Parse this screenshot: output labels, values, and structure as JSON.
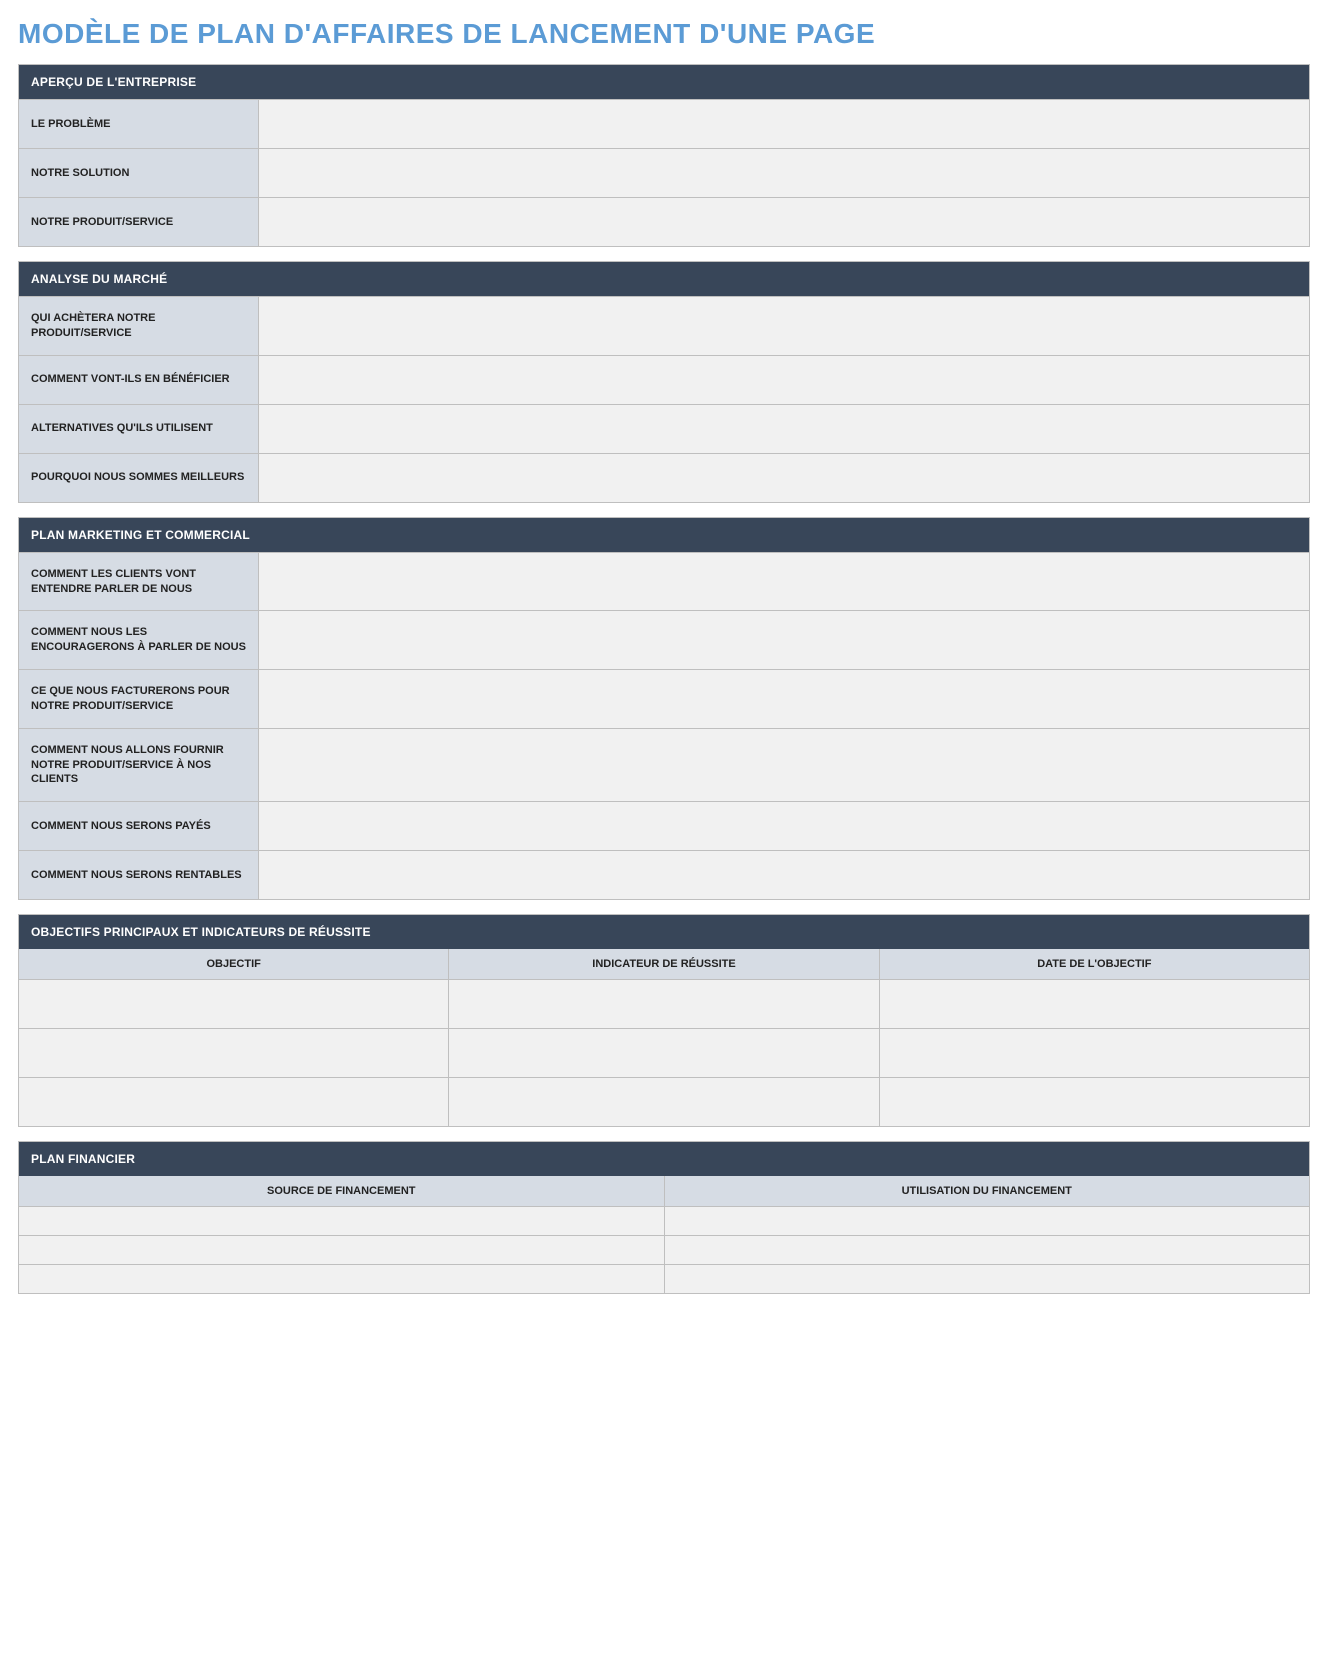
{
  "title": "MODÈLE DE PLAN D'AFFAIRES DE LANCEMENT D'UNE PAGE",
  "sections": {
    "overview": {
      "header": "APERÇU DE L'ENTREPRISE",
      "rows": [
        {
          "label": "LE PROBLÈME",
          "value": ""
        },
        {
          "label": "NOTRE SOLUTION",
          "value": ""
        },
        {
          "label": "NOTRE PRODUIT/SERVICE",
          "value": ""
        }
      ]
    },
    "market": {
      "header": "ANALYSE DU MARCHÉ",
      "rows": [
        {
          "label": "QUI ACHÈTERA NOTRE PRODUIT/SERVICE",
          "value": ""
        },
        {
          "label": "COMMENT VONT-ILS EN BÉNÉFICIER",
          "value": ""
        },
        {
          "label": "ALTERNATIVES QU'ILS UTILISENT",
          "value": ""
        },
        {
          "label": "POURQUOI NOUS SOMMES MEILLEURS",
          "value": ""
        }
      ]
    },
    "marketing": {
      "header": "PLAN MARKETING ET COMMERCIAL",
      "rows": [
        {
          "label": "COMMENT LES CLIENTS VONT ENTENDRE PARLER DE NOUS",
          "value": ""
        },
        {
          "label": "COMMENT NOUS LES ENCOURAGERONS À PARLER DE NOUS",
          "value": ""
        },
        {
          "label": "CE QUE NOUS FACTURERONS POUR NOTRE PRODUIT/SERVICE",
          "value": ""
        },
        {
          "label": "COMMENT NOUS ALLONS FOURNIR NOTRE PRODUIT/SERVICE À NOS CLIENTS",
          "value": ""
        },
        {
          "label": "COMMENT NOUS SERONS PAYÉS",
          "value": ""
        },
        {
          "label": "COMMENT NOUS SERONS RENTABLES",
          "value": ""
        }
      ]
    },
    "objectives": {
      "header": "OBJECTIFS PRINCIPAUX ET INDICATEURS DE RÉUSSITE",
      "columns": [
        "OBJECTIF",
        "INDICATEUR DE RÉUSSITE",
        "DATE DE L'OBJECTIF"
      ],
      "rows": [
        [
          "",
          "",
          ""
        ],
        [
          "",
          "",
          ""
        ],
        [
          "",
          "",
          ""
        ]
      ]
    },
    "financial": {
      "header": "PLAN FINANCIER",
      "columns": [
        "SOURCE DE FINANCEMENT",
        "UTILISATION DU FINANCEMENT"
      ],
      "rows": [
        [
          "",
          ""
        ],
        [
          "",
          ""
        ],
        [
          "",
          ""
        ]
      ]
    }
  }
}
